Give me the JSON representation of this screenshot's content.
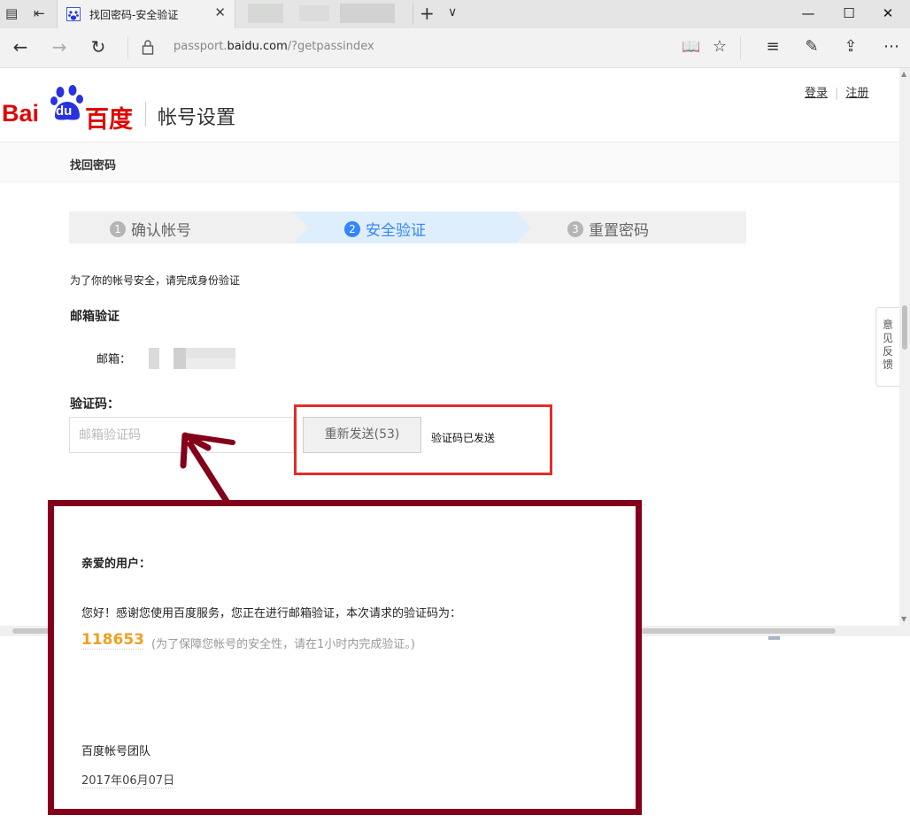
{
  "browser": {
    "tab_title": "找回密码-安全验证",
    "url_prefix": "passport.",
    "url_domain": "baidu.com",
    "url_path": "/?getpassindex"
  },
  "header": {
    "logo_text_left": "Bai",
    "logo_text_paw": "du",
    "logo_text_right": "百度",
    "section_title": "帐号设置",
    "login_link": "登录",
    "register_link": "注册"
  },
  "subbar": {
    "title": "找回密码"
  },
  "steps": [
    {
      "num": "1",
      "label": "确认帐号",
      "state": "done"
    },
    {
      "num": "2",
      "label": "安全验证",
      "state": "active"
    },
    {
      "num": "3",
      "label": "重置密码",
      "state": "todo"
    }
  ],
  "form": {
    "intro": "为了你的帐号安全，请完成身份验证",
    "section_title": "邮箱验证",
    "email_label": "邮箱：",
    "code_label": "验证码：",
    "code_placeholder": "邮箱验证码",
    "resend_label": "重新发送(53)",
    "sent_message": "验证码已发送"
  },
  "feedback": {
    "label": "意见反馈"
  },
  "email": {
    "greeting": "亲爱的用户：",
    "body": "您好！感谢您使用百度服务，您正在进行邮箱验证，本次请求的验证码为：",
    "code": "118653",
    "note": "(为了保障您帐号的安全性，请在1小时内完成验证。)",
    "team": "百度帐号团队",
    "date": "2017年06月07日"
  },
  "colors": {
    "brand_red": "#e10602",
    "brand_blue": "#2932e1",
    "active_step_bg": "#dfeefc",
    "active_step_text": "#3385ff",
    "annotation_red": "#e52b2b",
    "annotation_dark_red": "#84001a",
    "code_orange": "#f0a020"
  }
}
